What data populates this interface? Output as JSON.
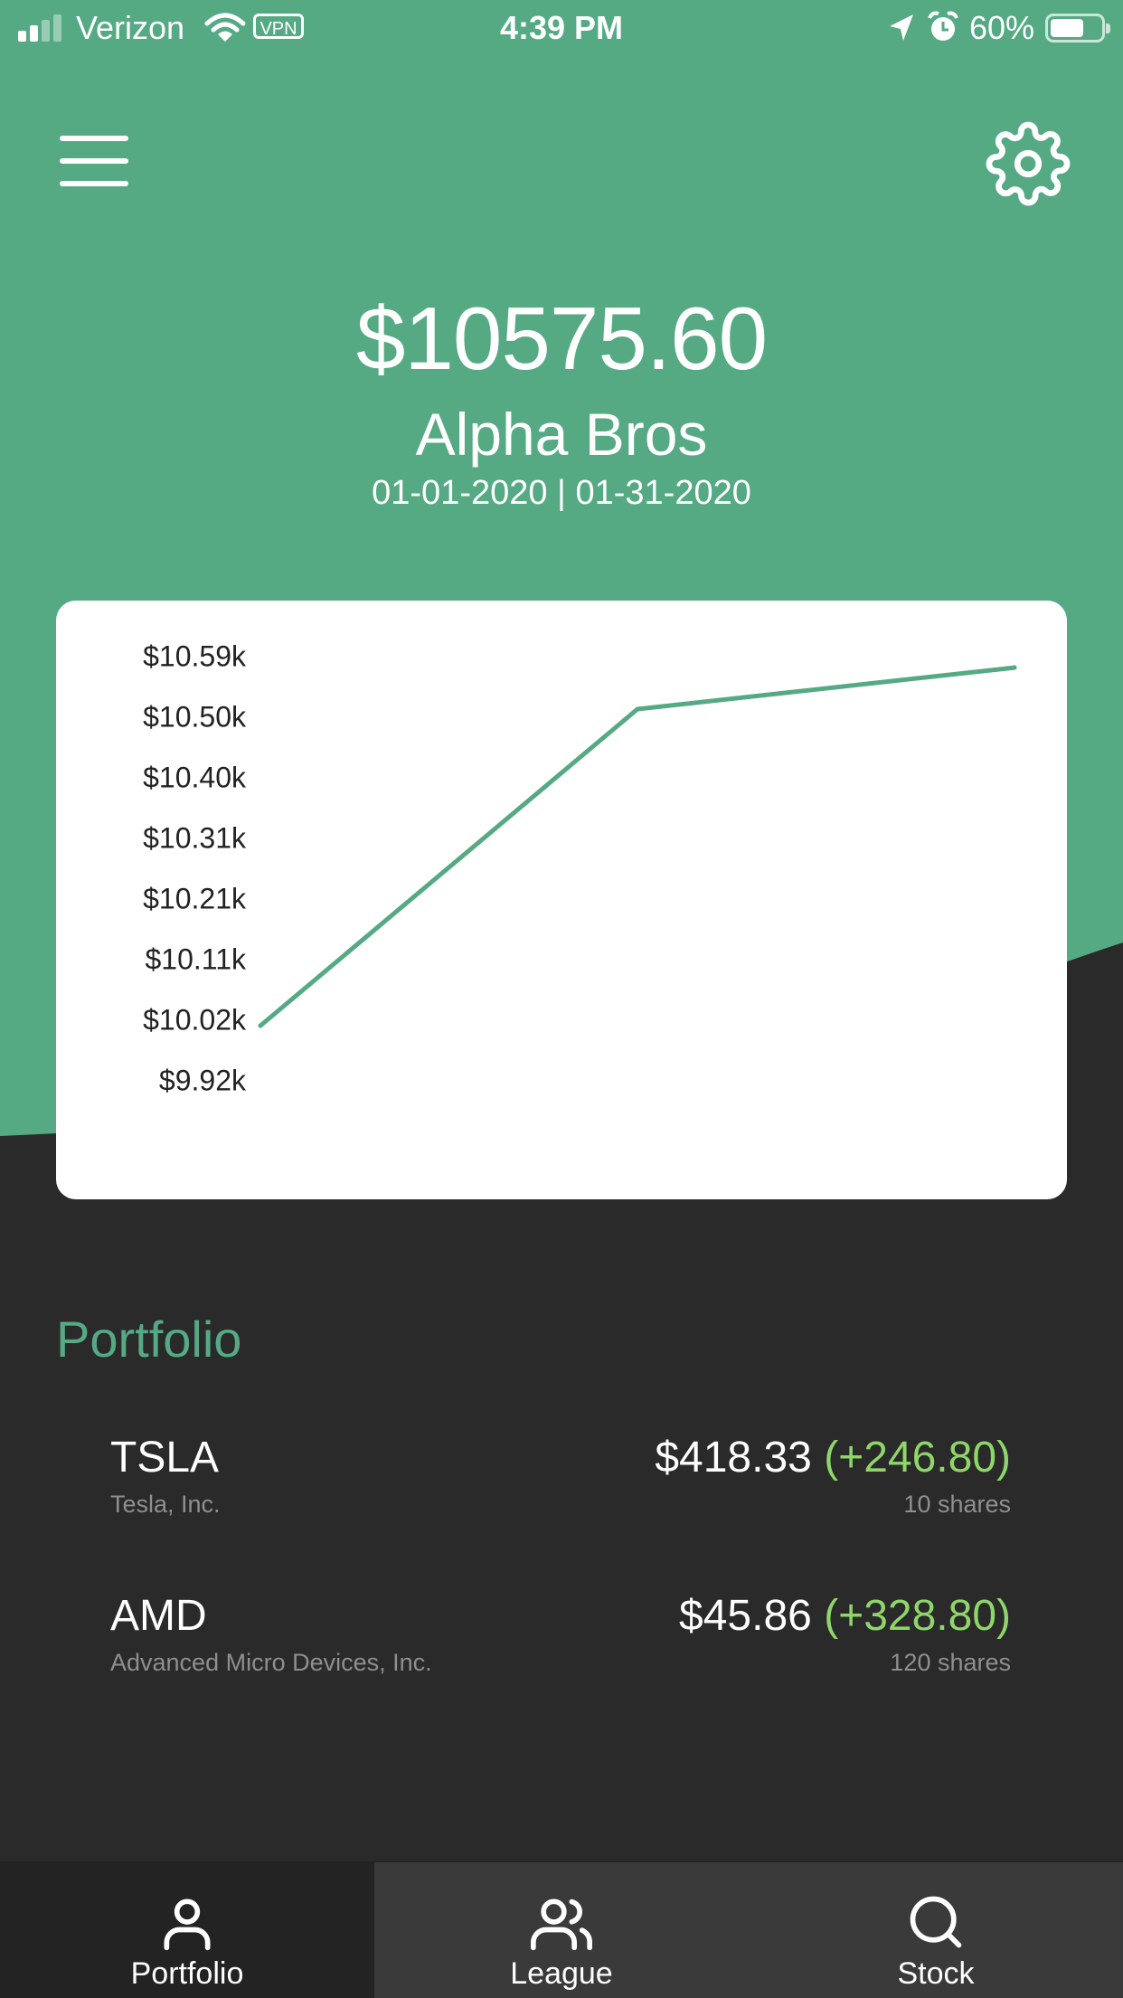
{
  "status_bar": {
    "carrier": "Verizon",
    "vpn": "VPN",
    "time": "4:39 PM",
    "battery": "60%",
    "battery_level": 0.6
  },
  "header": {
    "balance": "$10575.60",
    "league_name": "Alpha Bros",
    "date_range": "01-01-2020 | 01-31-2020"
  },
  "colors": {
    "brand_green": "#55aa84",
    "background_dark": "#2a2a2a",
    "gain_green": "#8fd66a"
  },
  "chart_data": {
    "type": "line",
    "y_tick_labels": [
      "$10.59k",
      "$10.50k",
      "$10.40k",
      "$10.31k",
      "$10.21k",
      "$10.11k",
      "$10.02k",
      "$9.92k"
    ],
    "y_ticks": [
      10590,
      10500,
      10400,
      10310,
      10210,
      10110,
      10020,
      9920
    ],
    "ylim": [
      9920,
      10590
    ],
    "values": [
      10010,
      10510,
      10575.6
    ],
    "grid": false,
    "color": "#55aa84"
  },
  "portfolio": {
    "title": "Portfolio",
    "holdings": [
      {
        "ticker": "TSLA",
        "company": "Tesla, Inc.",
        "price": "$418.33",
        "change": "(+246.80)",
        "shares": "10 shares"
      },
      {
        "ticker": "AMD",
        "company": "Advanced Micro Devices, Inc.",
        "price": "$45.86",
        "change": "(+328.80)",
        "shares": "120 shares"
      }
    ]
  },
  "tabs": [
    {
      "label": "Portfolio",
      "icon": "user-icon",
      "active": true
    },
    {
      "label": "League",
      "icon": "users-icon",
      "active": false
    },
    {
      "label": "Stock",
      "icon": "search-icon",
      "active": false
    }
  ]
}
